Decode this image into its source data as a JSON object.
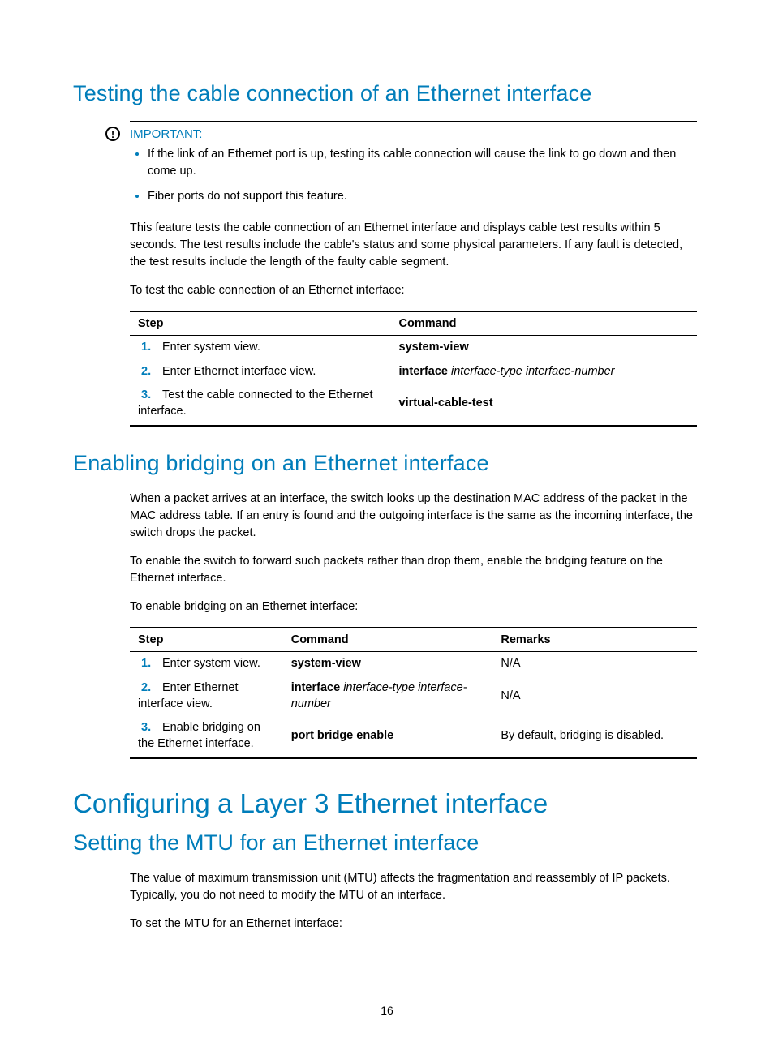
{
  "section1": {
    "heading": "Testing the cable connection of an Ethernet interface",
    "important_label": "IMPORTANT:",
    "bullets": [
      "If the link of an Ethernet port is up, testing its cable connection will cause the link to go down and then come up.",
      "Fiber ports do not support this feature."
    ],
    "para1": "This feature tests the cable connection of an Ethernet interface and displays cable test results within 5 seconds. The test results include the cable's status and some physical parameters. If any fault is detected, the test results include the length of the faulty cable segment.",
    "para2": "To test the cable connection of an Ethernet interface:",
    "table": {
      "headers": [
        "Step",
        "Command"
      ],
      "rows": [
        {
          "n": "1.",
          "step": "Enter system view.",
          "cmd_b": "system-view",
          "cmd_i": ""
        },
        {
          "n": "2.",
          "step": "Enter Ethernet interface view.",
          "cmd_b": "interface",
          "cmd_i": " interface-type interface-number"
        },
        {
          "n": "3.",
          "step": "Test the cable connected to the Ethernet interface.",
          "cmd_b": "virtual-cable-test",
          "cmd_i": ""
        }
      ]
    }
  },
  "section2": {
    "heading": "Enabling bridging on an Ethernet interface",
    "para1": "When a packet arrives at an interface, the switch looks up the destination MAC address of the packet in the MAC address table. If an entry is found and the outgoing interface is the same as the incoming interface, the switch drops the packet.",
    "para2": "To enable the switch to forward such packets rather than drop them, enable the bridging feature on the Ethernet interface.",
    "para3": "To enable bridging on an Ethernet interface:",
    "table": {
      "headers": [
        "Step",
        "Command",
        "Remarks"
      ],
      "rows": [
        {
          "n": "1.",
          "step": "Enter system view.",
          "cmd_b": "system-view",
          "cmd_i": "",
          "remarks": "N/A"
        },
        {
          "n": "2.",
          "step": "Enter Ethernet interface view.",
          "cmd_b": "interface",
          "cmd_i": " interface-type interface-number",
          "remarks": "N/A"
        },
        {
          "n": "3.",
          "step": "Enable bridging on the Ethernet interface.",
          "cmd_b": "port bridge enable",
          "cmd_i": "",
          "remarks": "By default, bridging is disabled."
        }
      ]
    }
  },
  "section3": {
    "main_heading": "Configuring a Layer 3 Ethernet interface",
    "sub_heading": "Setting the MTU for an Ethernet interface",
    "para1": "The value of maximum transmission unit (MTU) affects the fragmentation and reassembly of IP packets. Typically, you do not need to modify the MTU of an interface.",
    "para2": "To set the MTU for an Ethernet interface:"
  },
  "page_number": "16",
  "chart_data": [
    {
      "type": "table",
      "title": "To test the cable connection of an Ethernet interface",
      "headers": [
        "Step",
        "Command"
      ],
      "rows": [
        [
          "1. Enter system view.",
          "system-view"
        ],
        [
          "2. Enter Ethernet interface view.",
          "interface interface-type interface-number"
        ],
        [
          "3. Test the cable connected to the Ethernet interface.",
          "virtual-cable-test"
        ]
      ]
    },
    {
      "type": "table",
      "title": "To enable bridging on an Ethernet interface",
      "headers": [
        "Step",
        "Command",
        "Remarks"
      ],
      "rows": [
        [
          "1. Enter system view.",
          "system-view",
          "N/A"
        ],
        [
          "2. Enter Ethernet interface view.",
          "interface interface-type interface-number",
          "N/A"
        ],
        [
          "3. Enable bridging on the Ethernet interface.",
          "port bridge enable",
          "By default, bridging is disabled."
        ]
      ]
    }
  ]
}
